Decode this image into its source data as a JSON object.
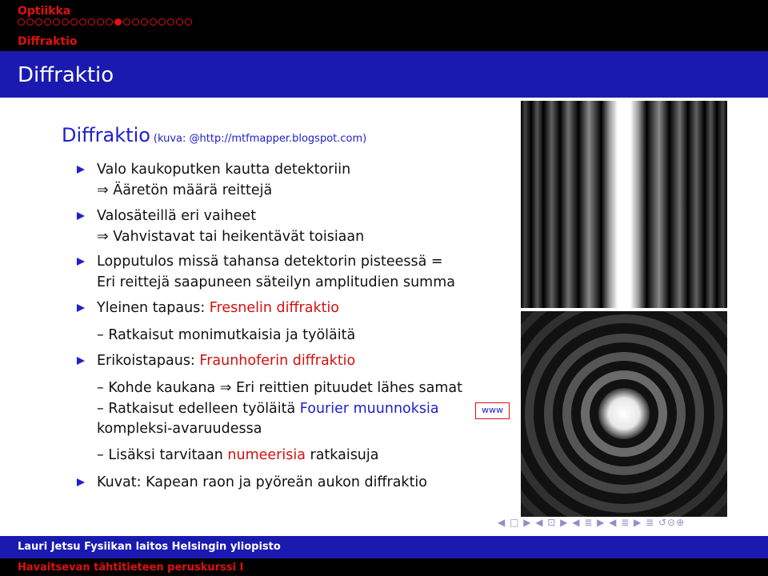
{
  "header": {
    "course_title": "Optiikka",
    "nav_dots": [
      false,
      false,
      false,
      false,
      false,
      false,
      false,
      false,
      false,
      false,
      false,
      true,
      false,
      false,
      false,
      false,
      false,
      false,
      false,
      false
    ],
    "section_title": "Diffraktio"
  },
  "frame": {
    "title": "Diffraktio"
  },
  "block": {
    "heading": "Diffraktio",
    "source": "(kuva: @http://mtfmapper.blogspot.com)"
  },
  "items": {
    "b1_a": "Valo kaukoputken kautta detektoriin",
    "b1_b": "⇒ Ääretön määrä reittejä",
    "b2_a": "Valosäteillä eri vaiheet",
    "b2_b": "⇒ Vahvistavat tai heikentävät toisiaan",
    "b3_a": "Lopputulos missä tahansa detektorin pisteessä =",
    "b3_b": "Eri reittejä saapuneen säteilyn amplitudien summa",
    "b4_prefix": "Yleinen tapaus: ",
    "b4_link": "Fresnelin diffraktio",
    "b4_sub": "– Ratkaisut monimutkaisia ja työläitä",
    "b5_prefix": "Erikoistapaus: ",
    "b5_link": "Fraunhoferin diffraktio",
    "b5_sub1": "– Kohde kaukana ⇒ Eri reittien pituudet lähes samat",
    "b5_sub2_prefix": "– Ratkaisut edelleen työläitä ",
    "b5_sub2_link": "Fourier muunnoksia",
    "b5_sub2_cont": "kompleksi-avaruudessa",
    "b5_sub3_prefix": "– Lisäksi tarvitaan ",
    "b5_sub3_link": "numeerisia",
    "b5_sub3_suffix": " ratkaisuja",
    "b6": "Kuvat: Kapean raon ja pyöreän aukon diffraktio",
    "www": "www"
  },
  "images": {
    "slit": "single-slit-diffraction-pattern",
    "aperture": "circular-aperture-airy-pattern"
  },
  "beamer_nav": "◀ □ ▶ ◀ ⊡ ▶ ◀ ≣ ▶ ◀ ≣ ▶ ≣ ↺⊝⊕",
  "footer": {
    "authors": "Lauri Jetsu  Fysiikan laitos  Helsingin yliopisto",
    "course": "Havaitsevan tähtitieteen peruskurssi I"
  },
  "colors": {
    "header_bg": "#000000",
    "title_bar": "#1a1ab0",
    "accent_red": "#d01010",
    "accent_blue": "#2020cc"
  }
}
